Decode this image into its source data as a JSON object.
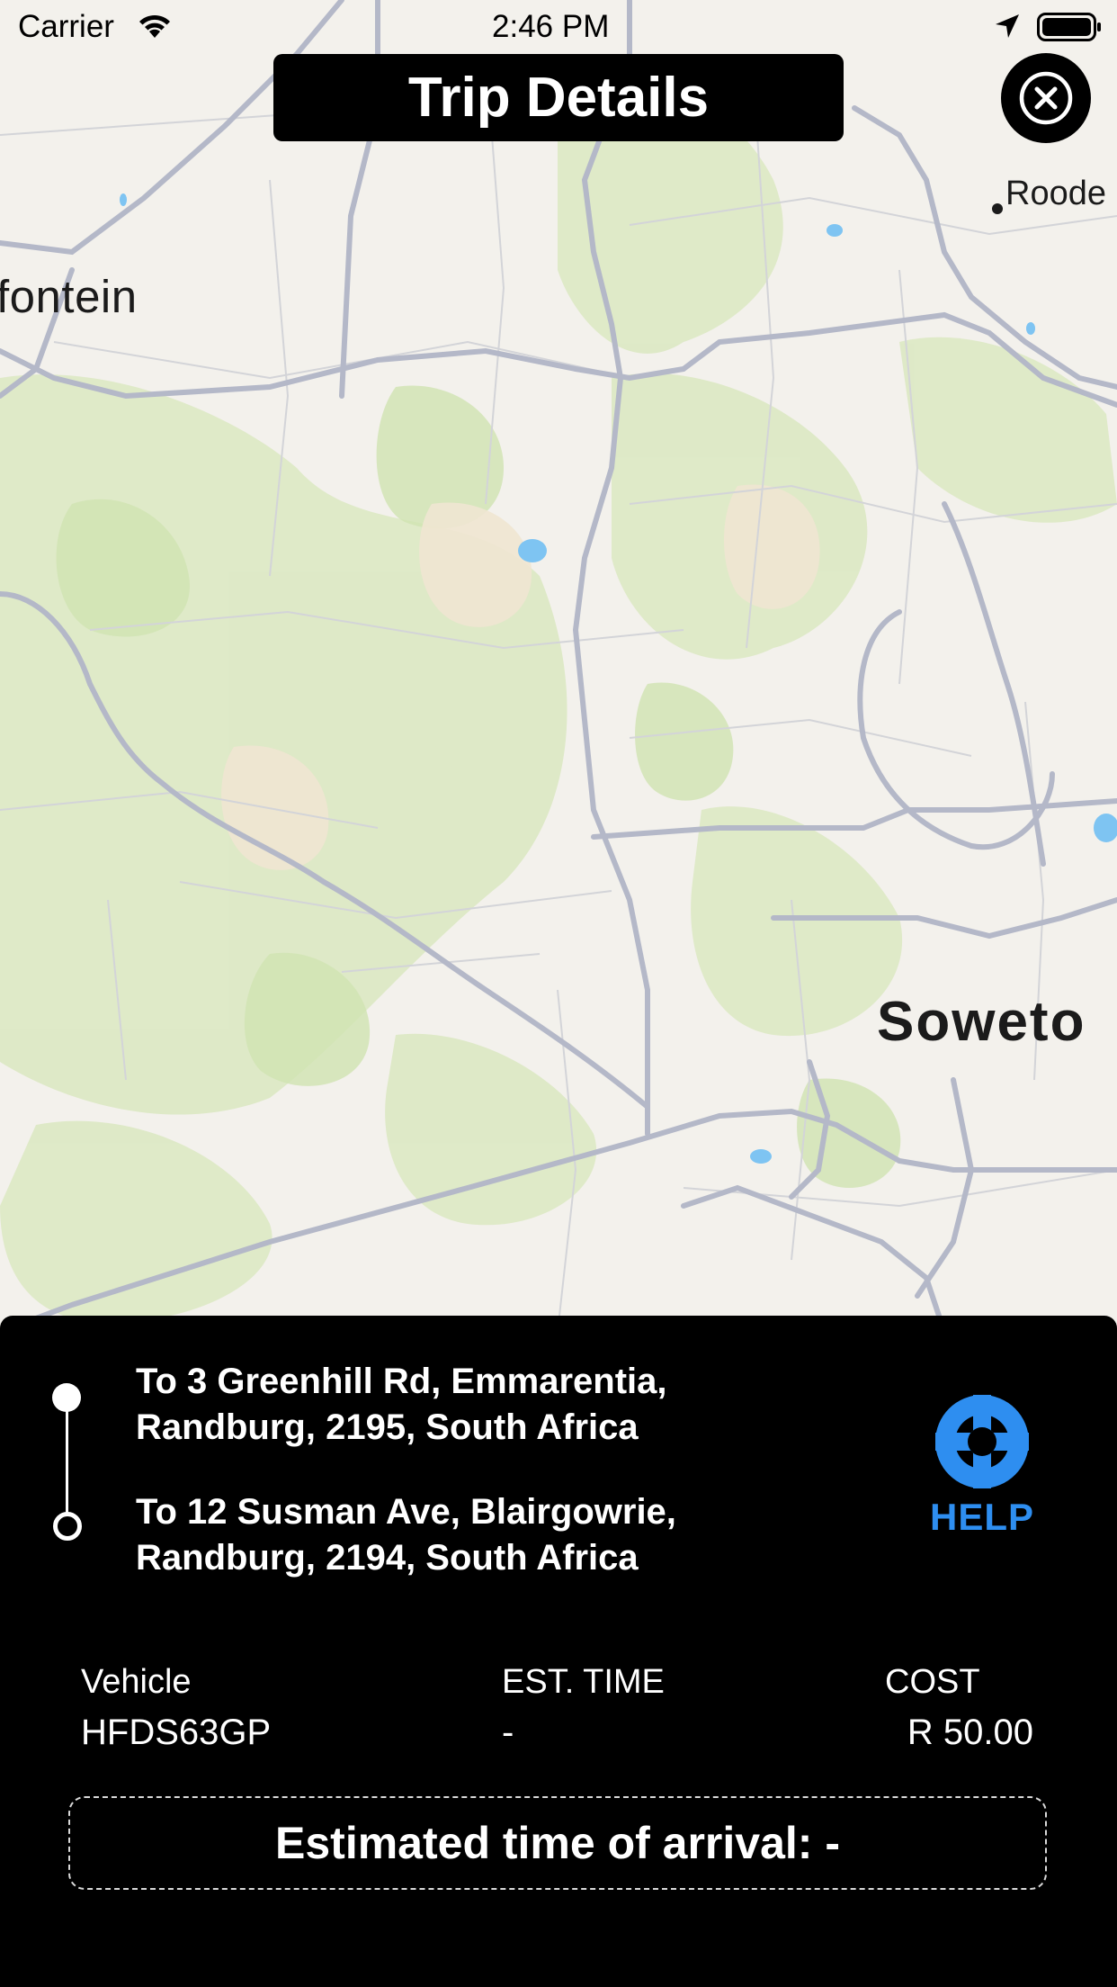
{
  "status_bar": {
    "carrier": "Carrier",
    "time": "2:46 PM"
  },
  "header": {
    "title": "Trip Details",
    "close_icon": "close-circle-icon"
  },
  "map": {
    "labels": {
      "fontein": "fontein",
      "roode": "Roode",
      "soweto": "Soweto"
    },
    "colors": {
      "land": "#f3f1ec",
      "park": "#dcebc4",
      "road": "#b3b7c6",
      "water": "#7ec4f2"
    }
  },
  "trip": {
    "pickup": {
      "line1": "To 3 Greenhill Rd, Emmarentia,",
      "line2": "Randburg, 2195, South Africa"
    },
    "dropoff": {
      "line1": "To 12 Susman Ave, Blairgowrie,",
      "line2": "Randburg, 2194, South Africa"
    },
    "help": {
      "label": "HELP",
      "icon": "lifebuoy-icon",
      "color": "#2e8ef0"
    },
    "vehicle": {
      "label": "Vehicle",
      "value": "HFDS63GP"
    },
    "est_time": {
      "label": "EST. TIME",
      "value": "-"
    },
    "cost": {
      "label": "COST",
      "value": "R 50.00"
    },
    "eta_text": "Estimated time of arrival: -"
  }
}
